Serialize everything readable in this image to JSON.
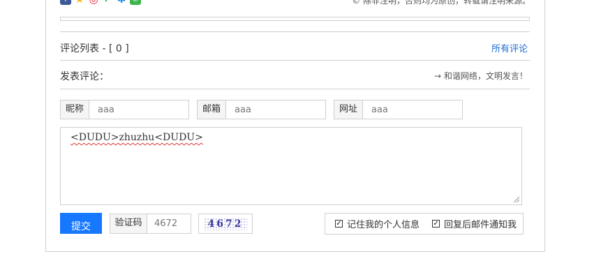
{
  "share": {
    "icons": [
      {
        "name": "facebook-icon",
        "glyph": "f",
        "color": "#3b5998"
      },
      {
        "name": "star-icon",
        "glyph": "★",
        "color": "#f5b400"
      },
      {
        "name": "weibo-icon",
        "glyph": "◎",
        "color": "#e6162d"
      },
      {
        "name": "tencent-icon",
        "glyph": "P",
        "color": "#2ab36c"
      },
      {
        "name": "qzone-icon",
        "glyph": "✱",
        "color": "#1b8ee8"
      },
      {
        "name": "wechat-icon",
        "glyph": "✆",
        "color": "#3bb54a"
      }
    ]
  },
  "copyright": "© 除非注明，否则均为原创，转载请注明来源。",
  "comments": {
    "list_title": "评论列表 - [ 0 ]",
    "all_link": "所有评论",
    "post_title": "发表评论：",
    "slogan": "→ 和谐网络，文明发言！"
  },
  "form": {
    "nickname_label": "昵称",
    "nickname_value": "aaa",
    "email_label": "邮箱",
    "email_value": "aaa",
    "website_label": "网址",
    "website_value": "aaa",
    "comment_text": "<DUDU>zhuzhu<DUDU>",
    "submit_label": "提交",
    "captcha_label": "验证码",
    "captcha_value": "4672",
    "captcha_image_text": "4672",
    "remember_label": "记住我的个人信息",
    "notify_label": "回复后邮件通知我"
  },
  "colors": {
    "accent": "#1677ff",
    "link": "#1f6bd6",
    "border": "#cfcfcf"
  }
}
